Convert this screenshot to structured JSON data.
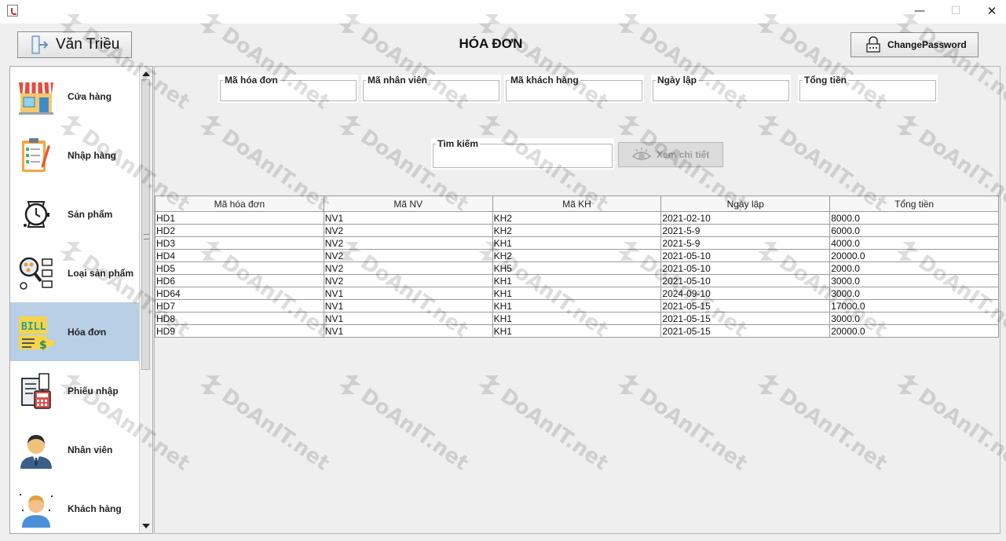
{
  "window": {
    "close_glyph": "✕",
    "minimize_glyph": "—",
    "maximize_glyph": "☐"
  },
  "header": {
    "user_button_label": "Văn Triều",
    "title": "HÓA ĐƠN",
    "change_password_label": "ChangePassword"
  },
  "sidebar": {
    "items": [
      {
        "label": "Cửa hàng",
        "icon": "store-icon"
      },
      {
        "label": "Nhập hàng",
        "icon": "clipboard-checklist-icon"
      },
      {
        "label": "Sản phẩm",
        "icon": "watch-icon"
      },
      {
        "label": "Loại sản phẩm",
        "icon": "category-search-icon"
      },
      {
        "label": "Hóa đơn",
        "icon": "bill-icon",
        "active": true
      },
      {
        "label": "Phiếu nhập",
        "icon": "receipt-calculator-icon"
      },
      {
        "label": "Nhân viên",
        "icon": "employee-icon"
      },
      {
        "label": "Khách hàng",
        "icon": "customer-icon"
      }
    ]
  },
  "filters": {
    "ma_hoa_don": {
      "legend": "Mã hóa đơn",
      "value": ""
    },
    "ma_nhan_vien": {
      "legend": "Mã nhân viên",
      "value": ""
    },
    "ma_khach_hang": {
      "legend": "Mã khách hàng",
      "value": ""
    },
    "ngay_lap": {
      "legend": "Ngày lập",
      "value": ""
    },
    "tong_tien": {
      "legend": "Tổng tiền",
      "value": ""
    },
    "tim_kiem": {
      "legend": "Tìm kiếm",
      "value": ""
    }
  },
  "detail_button_label": "Xem chi tiết",
  "table": {
    "columns": [
      "Mã hóa đơn",
      "Mã NV",
      "Mã KH",
      "Ngày lập",
      "Tổng tiền"
    ],
    "rows": [
      [
        "HD1",
        "NV1",
        "KH2",
        "2021-02-10",
        "8000.0"
      ],
      [
        "HD2",
        "NV2",
        "KH2",
        "2021-5-9",
        "6000.0"
      ],
      [
        "HD3",
        "NV2",
        "KH1",
        "2021-5-9",
        "4000.0"
      ],
      [
        "HD4",
        "NV2",
        "KH2",
        "2021-05-10",
        "20000.0"
      ],
      [
        "HD5",
        "NV2",
        "KH5",
        "2021-05-10",
        "2000.0"
      ],
      [
        "HD6",
        "NV2",
        "KH1",
        "2021-05-10",
        "3000.0"
      ],
      [
        "HD64",
        "NV1",
        "KH1",
        "2024-09-10",
        "3000.0"
      ],
      [
        "HD7",
        "NV1",
        "KH1",
        "2021-05-15",
        "17000.0"
      ],
      [
        "HD8",
        "NV1",
        "KH1",
        "2021-05-15",
        "3000.0"
      ],
      [
        "HD9",
        "NV1",
        "KH1",
        "2021-05-15",
        "20000.0"
      ]
    ]
  },
  "watermark": {
    "text": "DoAnIT.net"
  },
  "colors": {
    "active_sidebar": "#b8cfe5",
    "border": "#9a9a9a",
    "background": "#efefef"
  }
}
